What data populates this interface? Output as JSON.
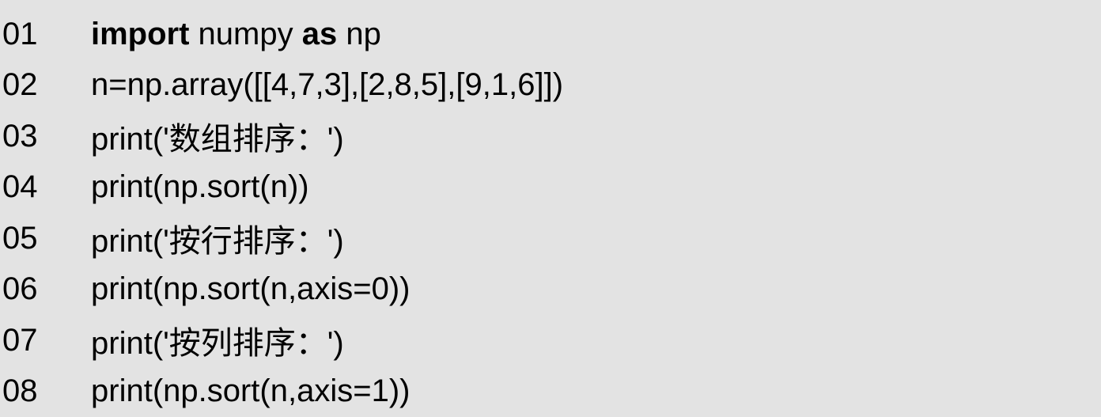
{
  "lines": [
    {
      "num": "01",
      "segments": [
        {
          "text": "import",
          "bold": true
        },
        {
          "text": " numpy ",
          "bold": false
        },
        {
          "text": "as",
          "bold": true
        },
        {
          "text": " np",
          "bold": false
        }
      ]
    },
    {
      "num": "02",
      "segments": [
        {
          "text": "n=np.array([[4,7,3],[2,8,5],[9,1,6]])",
          "bold": false
        }
      ]
    },
    {
      "num": "03",
      "segments": [
        {
          "text": "print('数组排序：')",
          "bold": false
        }
      ]
    },
    {
      "num": "04",
      "segments": [
        {
          "text": "print(np.sort(n))",
          "bold": false
        }
      ]
    },
    {
      "num": "05",
      "segments": [
        {
          "text": "print('按行排序：')",
          "bold": false
        }
      ]
    },
    {
      "num": "06",
      "segments": [
        {
          "text": "print(np.sort(n,axis=0))",
          "bold": false
        }
      ]
    },
    {
      "num": "07",
      "segments": [
        {
          "text": "print('按列排序：')",
          "bold": false
        }
      ]
    },
    {
      "num": "08",
      "segments": [
        {
          "text": "print(np.sort(n,axis=1))",
          "bold": false
        }
      ]
    }
  ]
}
